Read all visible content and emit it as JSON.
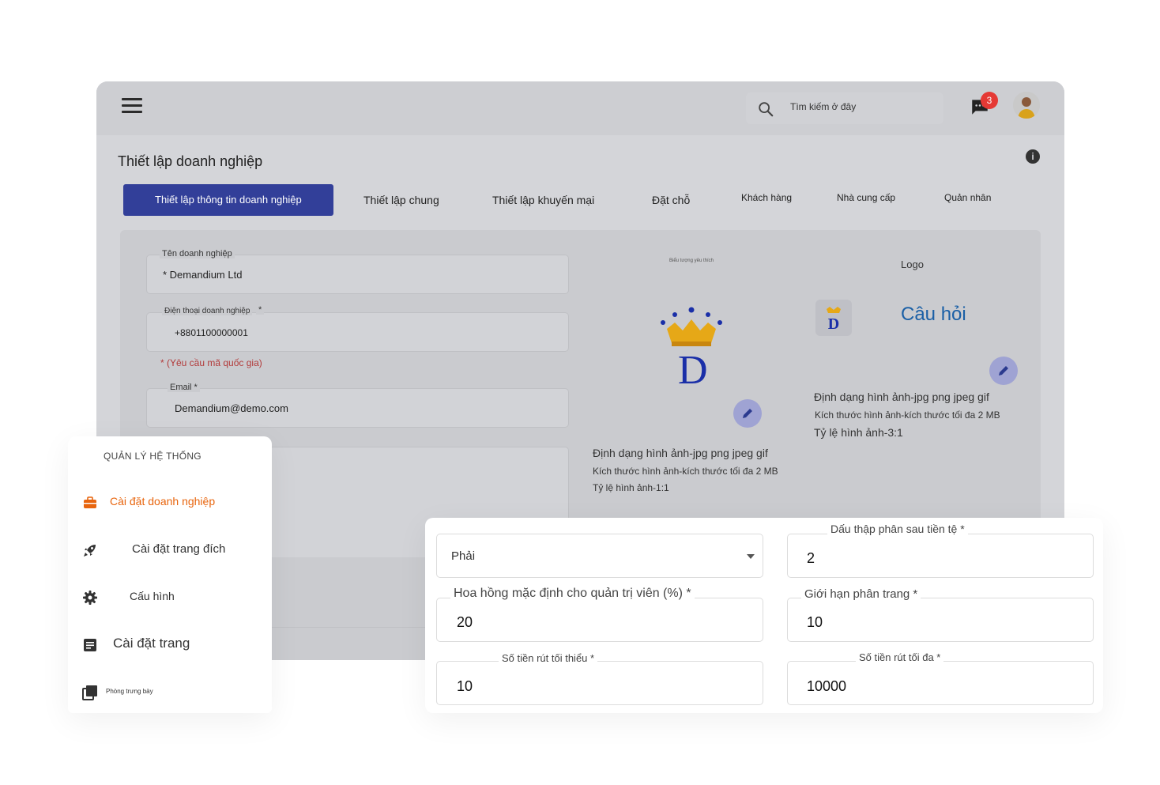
{
  "topbar": {
    "search_placeholder": "Tìm kiếm ở đây",
    "notification_count": "3"
  },
  "page": {
    "title": "Thiết lập doanh nghiệp",
    "info": "i"
  },
  "tabs": [
    {
      "label": "Thiết lập thông tin doanh nghiệp"
    },
    {
      "label": "Thiết lập chung"
    },
    {
      "label": "Thiết lập khuyến mại"
    },
    {
      "label": "Đặt chỗ"
    },
    {
      "label": "Khách hàng"
    },
    {
      "label": "Nhà cung cấp"
    },
    {
      "label": "Quản nhân"
    }
  ],
  "business_form": {
    "name_label": "Tên doanh nghiệp",
    "name_value": "* Demandium Ltd",
    "phone_label": "Điện thoại doanh nghiệp",
    "phone_required": "*",
    "phone_value": "+8801100000001",
    "phone_note": "* (Yêu cầu mã quốc gia)",
    "email_label": "Email *",
    "email_value": "Demandium@demo.com"
  },
  "favicon_panel": {
    "label": "Biểu tượng yêu thích",
    "letter": "D",
    "format": "Định dạng hình ảnh-jpg png jpeg gif",
    "size": "Kích thước hình ảnh-kích thước tối đa 2 MB",
    "ratio": "Tỷ lệ hình ảnh-1:1"
  },
  "logo_panel": {
    "label": "Logo",
    "name": "Câu hỏi",
    "format": "Định dạng hình ảnh-jpg png jpeg gif",
    "size": "Kích thước hình ảnh-kích thước tối đa 2 MB",
    "ratio": "Tỷ lệ hình ảnh-3:1"
  },
  "sidebar": {
    "header": "QUẢN LÝ HỆ THỐNG",
    "items": [
      {
        "label": "Cài đặt doanh nghiệp",
        "icon": "briefcase-icon",
        "active": true
      },
      {
        "label": "Cài đặt trang đích",
        "icon": "rocket-icon"
      },
      {
        "label": "Cấu hình",
        "icon": "gear-icon"
      },
      {
        "label": "Cài đặt trang",
        "icon": "document-icon"
      },
      {
        "label": "Phòng trưng bày",
        "icon": "gallery-icon"
      }
    ]
  },
  "settings": {
    "currency_position_value": "Phải",
    "decimal_label": "Dấu thập phân sau tiền tệ *",
    "decimal_value": "2",
    "commission_label": "Hoa hồng mặc định cho quản trị viên (%) *",
    "commission_value": "20",
    "pagination_label": "Giới hạn phân trang *",
    "pagination_value": "10",
    "min_withdraw_label": "Số tiền rút tối thiểu *",
    "min_withdraw_value": "10",
    "max_withdraw_label": "Số tiền rút tối đa *",
    "max_withdraw_value": "10000"
  },
  "colors": {
    "accent": "#323f99",
    "active_sidebar": "#e8650e",
    "badge": "#e53935",
    "logo_blue": "#1a2fa8"
  }
}
